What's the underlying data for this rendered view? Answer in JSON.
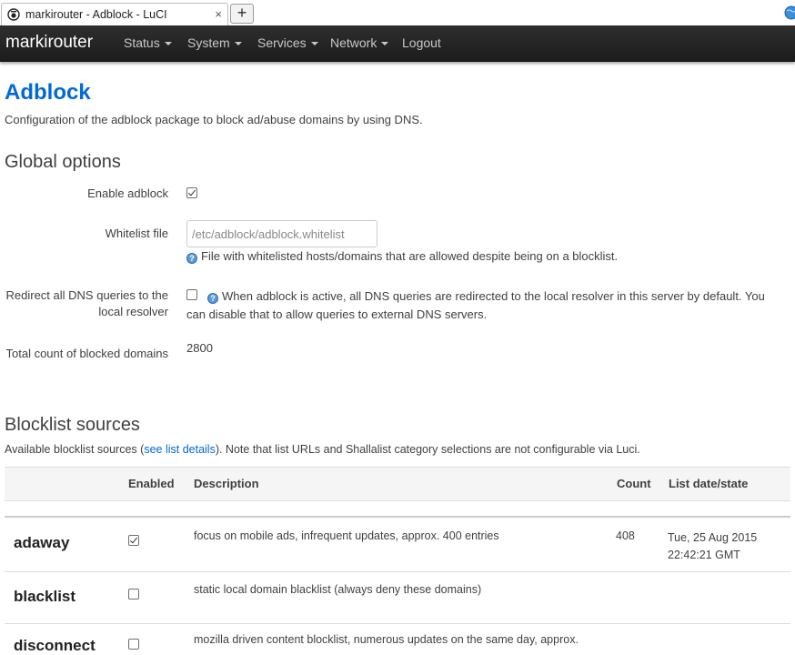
{
  "browser": {
    "tab_title": "markirouter - Adblock - LuCI",
    "tab_close": "×",
    "new_tab": "+"
  },
  "navbar": {
    "brand": "markirouter",
    "items": [
      "Status",
      "System",
      "Services",
      "Network",
      "Logout"
    ]
  },
  "page": {
    "title": "Adblock",
    "description": "Configuration of the adblock package to block ad/abuse domains by using DNS."
  },
  "global_options": {
    "title": "Global options",
    "enable_label": "Enable adblock",
    "enable_checked": true,
    "whitelist_label": "Whitelist file",
    "whitelist_value": "/etc/adblock/adblock.whitelist",
    "whitelist_help": "File with whitelisted hosts/domains that are allowed despite being on a blocklist.",
    "redirect_label_1": "Redirect all DNS queries to the",
    "redirect_label_2": "local resolver",
    "redirect_checked": false,
    "redirect_help_1": "When adblock is active, all DNS queries are redirected to the local resolver in this server by default. You",
    "redirect_help_2": "can disable that to allow queries to external DNS servers.",
    "count_label": "Total count of blocked domains",
    "count_value": "2800"
  },
  "blocklist": {
    "title": "Blocklist sources",
    "intro_prefix": "Available blocklist sources (",
    "intro_link": "see list details",
    "intro_suffix": "). Note that list URLs and Shallalist category selections are not configurable via Luci.",
    "headers": {
      "enabled": "Enabled",
      "description": "Description",
      "count": "Count",
      "state": "List date/state"
    },
    "rows": [
      {
        "name": "adaway",
        "enabled": true,
        "description": "focus on mobile ads, infrequent updates, approx. 400 entries",
        "count": "408",
        "state_1": "Tue, 25 Aug 2015",
        "state_2": "22:42:21 GMT"
      },
      {
        "name": "blacklist",
        "enabled": false,
        "description": "static local domain blacklist (always deny these domains)",
        "count": "",
        "state_1": "",
        "state_2": ""
      },
      {
        "name": "disconnect",
        "enabled": false,
        "description": "mozilla driven content blocklist, numerous updates on the same day, approx.",
        "count": "",
        "state_1": "",
        "state_2": ""
      }
    ]
  },
  "colors": {
    "accent": "#0069d6",
    "navbar": "#222222",
    "help_icon": "#5a9bd8"
  }
}
